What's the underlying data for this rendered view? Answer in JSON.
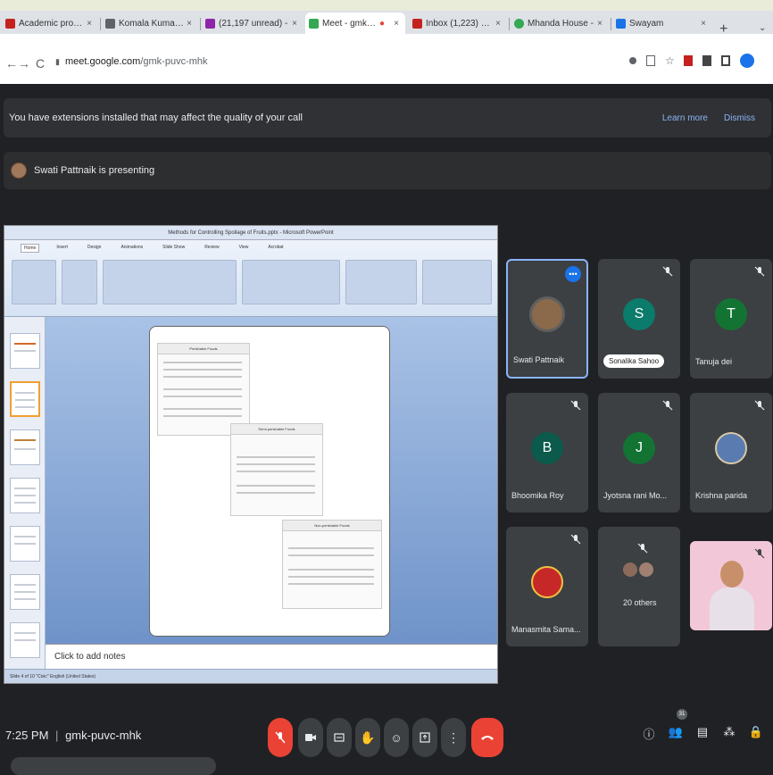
{
  "browser": {
    "tabs": [
      {
        "title": "Academic profile",
        "fav": "#c5221f"
      },
      {
        "title": "Komala Kumari Sa",
        "fav": "#5f6368"
      },
      {
        "title": "(21,197 unread) -",
        "fav": "#8e24aa"
      },
      {
        "title": "Meet - gmk-pu",
        "fav": "#34a853"
      },
      {
        "title": "Inbox (1,223) - jyo",
        "fav": "#c5221f"
      },
      {
        "title": "Mhanda House -",
        "fav": "#34a853"
      },
      {
        "title": "Swayam",
        "fav": "#1a73e8"
      }
    ],
    "tab_close": "×",
    "new_tab": "+",
    "url_domain": "meet.google.com",
    "url_path": "/gmk-puvc-mhk",
    "icons": {
      "back": "←",
      "forward": "→",
      "reload": "C",
      "lock": "🔒"
    }
  },
  "banner": {
    "text": "You have extensions installed that may affect the quality of your call",
    "learn_more": "Learn more",
    "dismiss": "Dismiss"
  },
  "presenting": {
    "text": "Swati Pattnaik is presenting"
  },
  "share": {
    "window_title": "Methods for Controlling Spoilage of Fruits.pptx - Microsoft PowerPoint",
    "ribbon_tabs": [
      "Home",
      "Insert",
      "Design",
      "Animations",
      "Slide Show",
      "Review",
      "View",
      "Acrobat"
    ],
    "notes_placeholder": "Click to add notes",
    "status": "Slide 4 of 10   \"Civic\"   English (United States)",
    "box1_title": "Perishable Foods",
    "box2_title": "Semi-perishable Foods",
    "box3_title": "Non-perishable Foods"
  },
  "participants": [
    {
      "name": "Swati Pattnaik",
      "initial": "",
      "color": "#8a6a4a",
      "speaker": true
    },
    {
      "name": "Sonalika Sahoo",
      "initial": "S",
      "color": "#0b7b6b",
      "speaker": false,
      "pill": true
    },
    {
      "name": "Tanuja dei",
      "initial": "T",
      "color": "#137333",
      "speaker": false
    },
    {
      "name": "Bhoomika Roy",
      "initial": "B",
      "color": "#0b5a4b",
      "speaker": false
    },
    {
      "name": "Jyotsna rani Mo...",
      "initial": "J",
      "color": "#137333",
      "speaker": false
    },
    {
      "name": "Krishna parida",
      "initial": "",
      "color": "#5a7bb0",
      "speaker": false
    },
    {
      "name": "Manasmita Sama...",
      "initial": "",
      "color": "#c62828",
      "speaker": false
    },
    {
      "name": "20 others",
      "initial": "",
      "color": "#8b6b5b",
      "speaker": false
    }
  ],
  "bottom": {
    "time": "7:25 PM",
    "separator": "|",
    "meeting_code": "gmk-puvc-mhk",
    "people_count": "31"
  }
}
